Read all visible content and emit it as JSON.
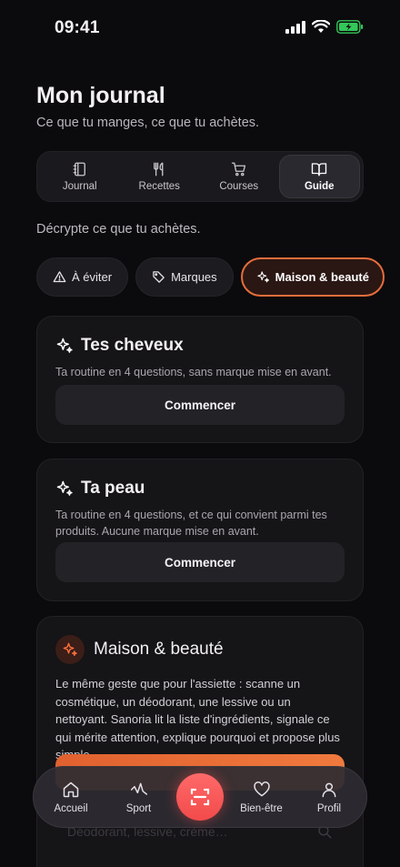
{
  "status": {
    "time": "09:41"
  },
  "header": {
    "title": "Mon journal",
    "subtitle": "Ce que tu manges, ce que tu achètes."
  },
  "tabs": [
    {
      "label": "Journal",
      "icon": "notebook-icon",
      "active": false
    },
    {
      "label": "Recettes",
      "icon": "utensils-icon",
      "active": false
    },
    {
      "label": "Courses",
      "icon": "cart-icon",
      "active": false
    },
    {
      "label": "Guide",
      "icon": "book-icon",
      "active": true
    }
  ],
  "section_hint": "Décrypte ce que tu achètes.",
  "chips": [
    {
      "label": "À éviter",
      "icon": "warning-icon",
      "active": false
    },
    {
      "label": "Marques",
      "icon": "tag-icon",
      "active": false
    },
    {
      "label": "Maison & beauté",
      "icon": "sparkles-icon",
      "active": true
    }
  ],
  "cards": {
    "hair": {
      "title": "Tes cheveux",
      "desc": "Ta routine en 4 questions, sans marque mise en avant.",
      "button": "Commencer"
    },
    "skin": {
      "title": "Ta peau",
      "desc": "Ta routine en 4 questions, et ce qui convient parmi tes produits. Aucune marque mise en avant.",
      "button": "Commencer"
    },
    "maison": {
      "title": "Maison & beauté",
      "desc": "Le même geste que pour l'assiette : scanne un cosmétique, un déodorant, une lessive ou un nettoyant. Sanoria lit la liste d'ingrédients, signale ce qui mérite attention, explique pourquoi et propose plus simple.",
      "search_placeholder": "Déodorant, lessive, crème…"
    }
  },
  "bottom_nav": {
    "items": [
      {
        "label": "Accueil",
        "icon": "home-icon"
      },
      {
        "label": "Sport",
        "icon": "activity-icon"
      },
      {
        "label": "Bien-être",
        "icon": "heart-icon"
      },
      {
        "label": "Profil",
        "icon": "user-icon"
      }
    ],
    "scan_icon": "scan-icon"
  },
  "colors": {
    "accent": "#e56d3c",
    "scan": "#f24a4a",
    "background": "#0b0a0c",
    "card": "#151417",
    "battery": "#34c759"
  }
}
